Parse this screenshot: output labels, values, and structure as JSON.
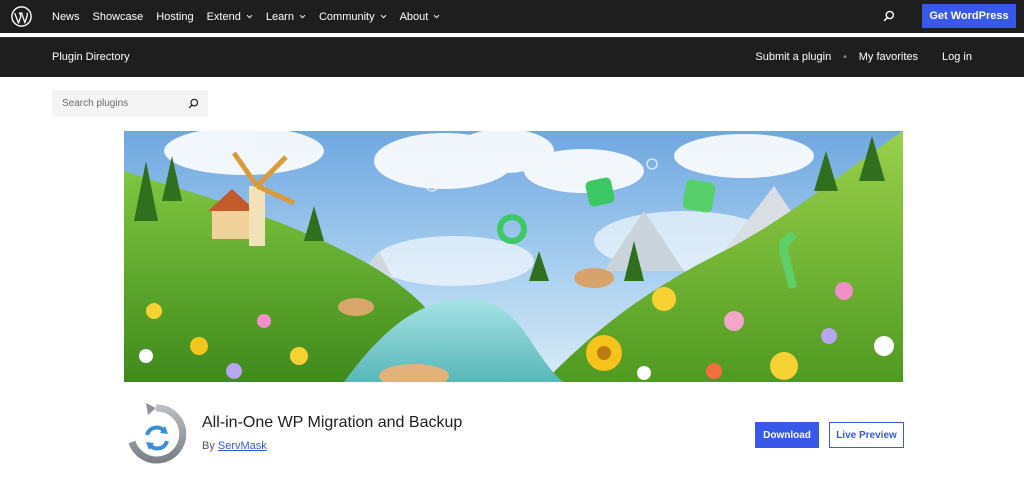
{
  "global_header": {
    "logo_icon": "wordpress-logo-icon",
    "nav": [
      {
        "label": "News",
        "has_dropdown": false
      },
      {
        "label": "Showcase",
        "has_dropdown": false
      },
      {
        "label": "Hosting",
        "has_dropdown": false
      },
      {
        "label": "Extend",
        "has_dropdown": true
      },
      {
        "label": "Learn",
        "has_dropdown": true
      },
      {
        "label": "Community",
        "has_dropdown": true
      },
      {
        "label": "About",
        "has_dropdown": true
      }
    ],
    "search_icon": "search-icon",
    "cta_label": "Get WordPress",
    "cta_color": "#3858e9",
    "background": "#1e1e1e"
  },
  "local_header": {
    "title": "Plugin Directory",
    "links": [
      "Submit a plugin",
      "My favorites",
      "Log in"
    ]
  },
  "search": {
    "placeholder": "Search plugins",
    "value": ""
  },
  "plugin": {
    "name": "All-in-One WP Migration and Backup",
    "by_label": "By",
    "author": "ServMask",
    "icon": "circular-arrows-icon",
    "download_label": "Download",
    "live_preview_label": "Live Preview"
  }
}
